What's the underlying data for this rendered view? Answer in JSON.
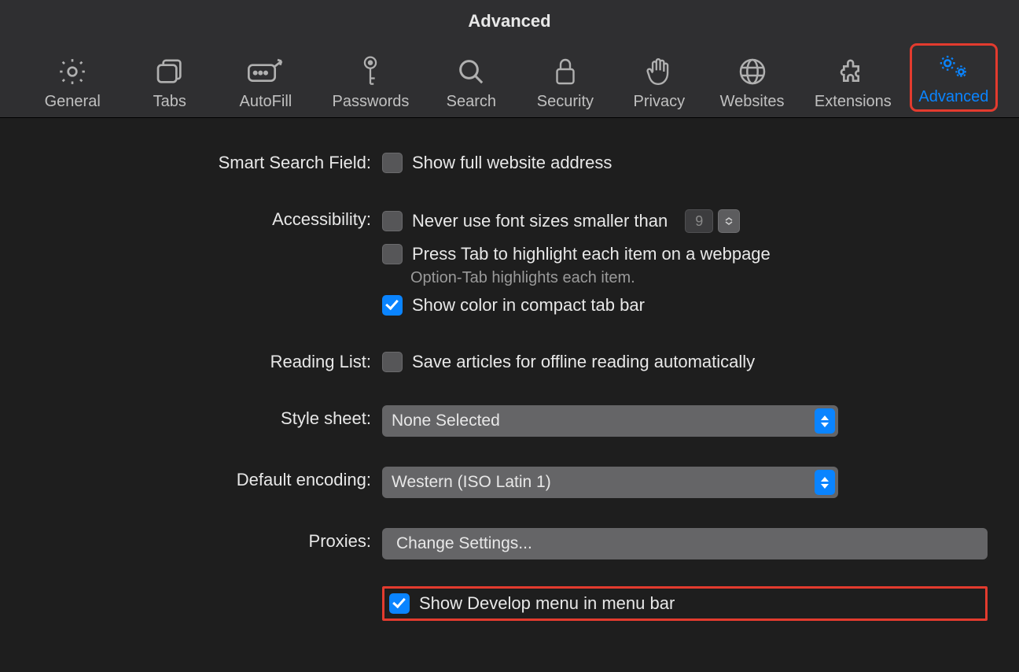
{
  "window": {
    "title": "Advanced"
  },
  "tabs": {
    "general": "General",
    "tabs": "Tabs",
    "autofill": "AutoFill",
    "passwords": "Passwords",
    "search": "Search",
    "security": "Security",
    "privacy": "Privacy",
    "websites": "Websites",
    "extensions": "Extensions",
    "advanced": "Advanced"
  },
  "labels": {
    "smart_search": "Smart Search Field:",
    "accessibility": "Accessibility:",
    "reading_list": "Reading List:",
    "style_sheet": "Style sheet:",
    "default_encoding": "Default encoding:",
    "proxies": "Proxies:"
  },
  "options": {
    "show_full_address": "Show full website address",
    "never_font_smaller": "Never use font sizes smaller than",
    "font_size_value": "9",
    "press_tab": "Press Tab to highlight each item on a webpage",
    "option_tab_hint": "Option-Tab highlights each item.",
    "show_color_tab": "Show color in compact tab bar",
    "save_offline": "Save articles for offline reading automatically",
    "style_sheet_value": "None Selected",
    "encoding_value": "Western (ISO Latin 1)",
    "change_settings": "Change Settings...",
    "show_develop": "Show Develop menu in menu bar"
  }
}
